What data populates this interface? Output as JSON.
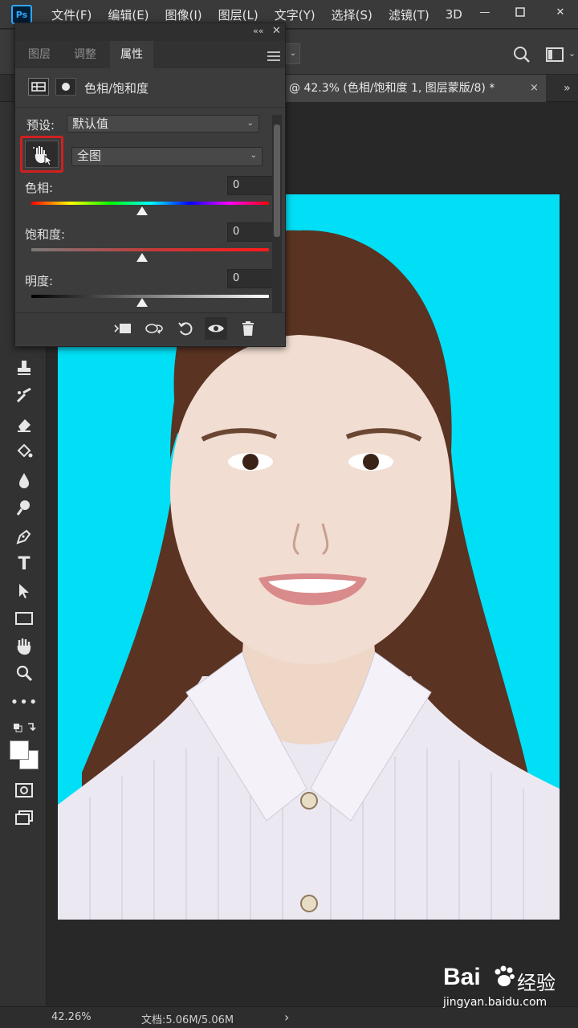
{
  "app": {
    "logo": "Ps",
    "menu": [
      "文件(F)",
      "编辑(E)",
      "图像(I)",
      "图层(L)",
      "文字(Y)",
      "选择(S)",
      "滤镜(T)",
      "3D"
    ]
  },
  "document_tab": {
    "title": "@ 42.3% (色相/饱和度 1, 图层蒙版/8) *",
    "close": "×",
    "more": "»"
  },
  "properties_panel": {
    "tabs": [
      "图层",
      "调整",
      "属性"
    ],
    "active_tab": "属性",
    "adjustment_name": "色相/饱和度",
    "preset_label": "预设:",
    "preset_value": "默认值",
    "range_value": "全图",
    "hue": {
      "label": "色相:",
      "value": "0"
    },
    "saturation": {
      "label": "饱和度:",
      "value": "0"
    },
    "lightness": {
      "label": "明度:",
      "value": "0"
    }
  },
  "status": {
    "zoom": "42.26%",
    "doc_info": "文档:5.06M/5.06M",
    "arrow": "›"
  },
  "watermark": {
    "brand": "Bai",
    "brand_cn": "经验",
    "url": "jingyan.baidu.com"
  },
  "icons": {
    "toolbar": [
      "stamp-icon",
      "history-brush-icon",
      "eraser-icon",
      "paint-bucket-icon",
      "blur-icon",
      "dodge-icon",
      "pen-icon",
      "type-icon",
      "path-selection-icon",
      "rectangle-icon",
      "hand-icon",
      "zoom-icon",
      "more-tools-icon",
      "swap-colors-icon",
      "color-swatches-icon",
      "quick-mask-icon",
      "screen-mode-icon"
    ],
    "footer": [
      "clip-to-layer-icon",
      "view-previous-icon",
      "reset-icon",
      "visibility-icon",
      "delete-icon"
    ]
  },
  "colors": {
    "background_photo": "#00dff5",
    "highlight": "#d21f1f",
    "ps_blue": "#31a8ff"
  }
}
